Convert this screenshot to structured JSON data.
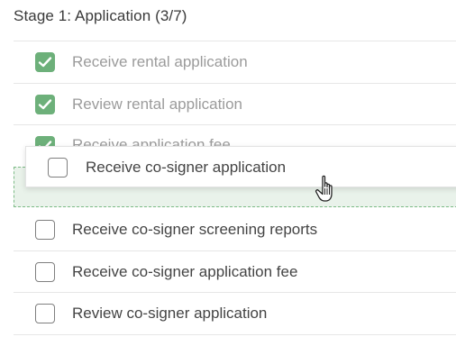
{
  "stage": {
    "title": "Stage 1: Application (3/7)"
  },
  "tasks": [
    {
      "label": "Receive rental application",
      "checked": true
    },
    {
      "label": "Review rental application",
      "checked": true
    },
    {
      "label": "Receive application fee",
      "checked": true
    },
    {
      "label": "Receive co-signer screening reports",
      "checked": false
    },
    {
      "label": "Receive co-signer application fee",
      "checked": false
    },
    {
      "label": "Review co-signer application",
      "checked": false
    }
  ],
  "dragging": {
    "label": "Receive co-signer application",
    "checked": false
  },
  "colors": {
    "checked_fill": "#6db07a",
    "drop_zone_fill": "#e9f2ea",
    "drop_zone_border": "#7cbb86"
  },
  "icons": {
    "check": "checkmark-icon",
    "cursor": "grab-hand-cursor-icon"
  }
}
